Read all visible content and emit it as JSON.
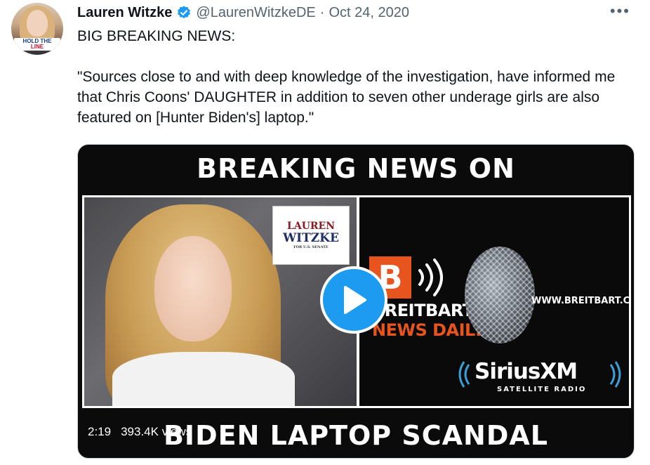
{
  "tweet": {
    "author": {
      "name": "Lauren Witzke",
      "handle": "@LaurenWitzkeDE",
      "avatar_badge_line1": "HOLD THE",
      "avatar_badge_line2": "LINE"
    },
    "separator": "·",
    "date": "Oct 24, 2020",
    "more_label": "•••",
    "text": {
      "line1": "BIG BREAKING NEWS:",
      "paragraph2": "\"Sources close to and with deep knowledge of the investigation, have informed me that Chris Coons' DAUGHTER in addition to seven other underage girls are also featured on [Hunter Biden's] laptop.\""
    },
    "media": {
      "type": "video",
      "top_banner": "BREAKING NEWS ON",
      "bottom_banner": "BIDEN LAPTOP SCANDAL",
      "sign": {
        "line1": "LAUREN",
        "line2": "WITZKE",
        "line3": "FOR U.S. SENATE"
      },
      "breitbart": {
        "logo_letter": "B",
        "name": "BREITBART",
        "show": "NEWS DAILY",
        "url": "WWW.BREITBART.COM"
      },
      "siriusxm": {
        "word": "SiriusXM",
        "sub": "SATELLITE RADIO"
      },
      "duration": "2:19",
      "views": "393.4K views"
    }
  },
  "colors": {
    "verified": "#1d9bf0",
    "play_button": "#1d9bf0",
    "breitbart_orange": "#e8541d",
    "secondary_text": "#536471"
  }
}
